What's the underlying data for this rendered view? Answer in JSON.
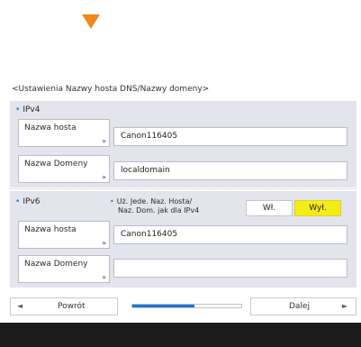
{
  "title": "<Ustawienia Nazwy hosta DNS/Nazwy domeny>",
  "ipv4": {
    "section_label": "IPv4",
    "host_button": "Nazwa hosta",
    "host_value": "Canon116405",
    "domain_button": "Nazwa Domeny",
    "domain_value": "localdomain"
  },
  "ipv6": {
    "section_label": "IPv6",
    "note_line1": "Uż. Jede. Naz. Hosta/",
    "note_line2": "Naz. Dom. jak dla IPv4",
    "toggle_on": "Wł.",
    "toggle_off": "Wył.",
    "toggle_selected": "Wył.",
    "host_button": "Nazwa hosta",
    "host_value": "Canon116405",
    "domain_button": "Nazwa Domeny",
    "domain_value": ""
  },
  "corner_mark": "»",
  "nav": {
    "back_label": "Powrót",
    "next_label": "Dalej",
    "back_arrow": "◄",
    "next_arrow": "►"
  },
  "progress": {
    "fraction": 0.57,
    "color": "#1976d2"
  },
  "colors": {
    "accent": "#1f7fd6",
    "selected_toggle": "#f6ec18",
    "indicator_arrow": "#ee8a1a"
  },
  "icons": {
    "indicator": "down-arrow-icon",
    "back": "left-arrow-icon",
    "next": "right-arrow-icon"
  }
}
